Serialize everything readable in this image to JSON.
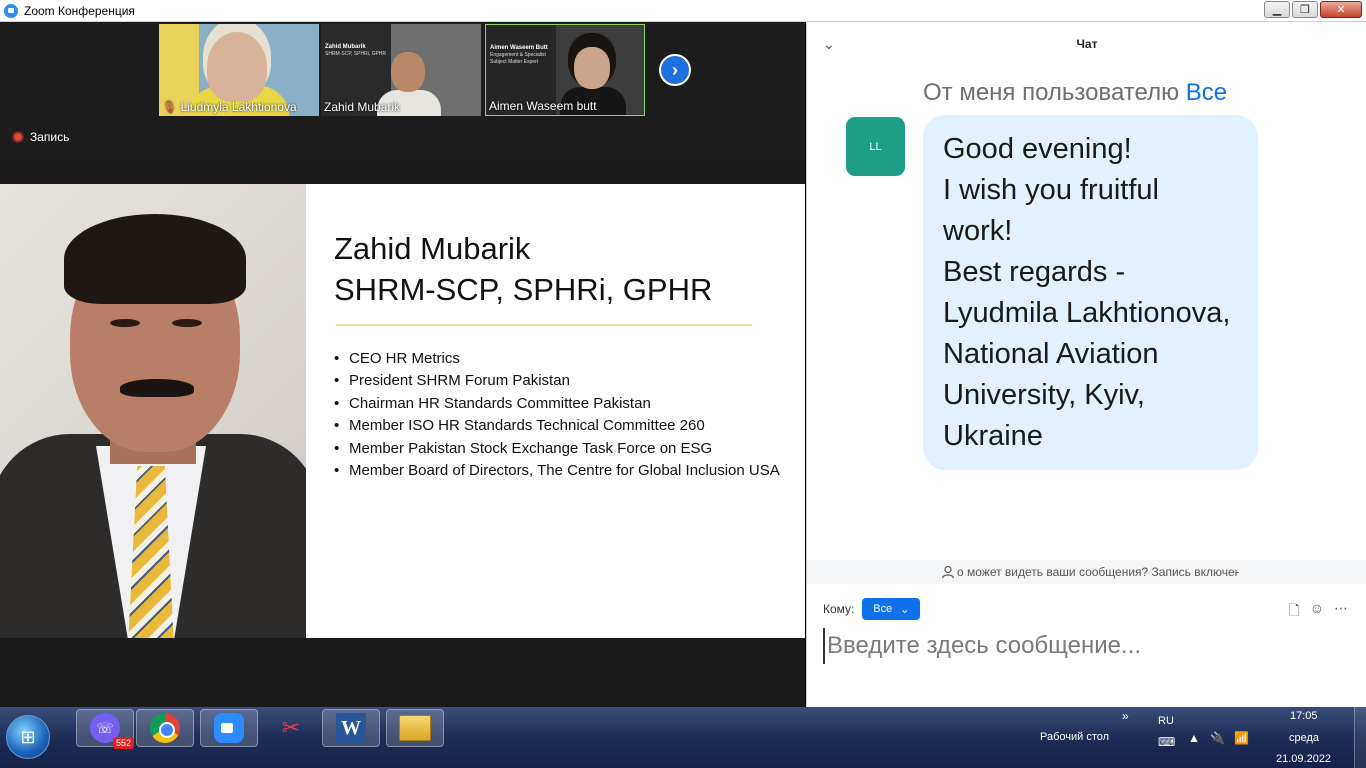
{
  "window": {
    "title": "Zoom Конференция",
    "buttons": {
      "minimize": "▁",
      "maximize": "❐",
      "close": "✕"
    }
  },
  "participants": [
    {
      "name": "Liudmyla Lakhtionova",
      "muted": true
    },
    {
      "name": "Zahid Mubarik"
    },
    {
      "name": "Aimen Waseem butt"
    }
  ],
  "recording": {
    "label": "Запись"
  },
  "slide": {
    "title_line1": "Zahid Mubarik",
    "title_line2": "SHRM-SCP, SPHRi, GPHR",
    "bullets": [
      "CEO HR Metrics",
      "President SHRM Forum Pakistan",
      "Chairman HR Standards Committee Pakistan",
      "Member ISO HR Standards Technical Committee 260",
      "Member Pakistan Stock Exchange Task Force on ESG",
      "Member Board of Directors, The Centre for Global Inclusion USA"
    ]
  },
  "thumb_slides": {
    "t2_title": "Zahid Mubarik",
    "t2_sub": "SHRM-SCP, SPHRi, GPHR",
    "t3_title": "Aimen Waseem Butt",
    "t3_sub": "Engagement & Specialist Subject Matter Expert"
  },
  "chat": {
    "title": "Чат",
    "from_prefix": "От меня пользователю",
    "from_target": "Все",
    "avatar_initials": "LL",
    "message_lines": [
      "Good evening!",
      "I wish you fruitful",
      "work!",
      "Best regards -",
      "Lyudmila Lakhtionova,",
      "National Aviation",
      "University, Kyiv,",
      "Ukraine"
    ],
    "notice": "о может видеть ваши сообщения? Запись включена",
    "to_label": "Кому:",
    "to_value": "Все",
    "input_placeholder": "Введите здесь сообщение..."
  },
  "taskbar": {
    "viber_badge": "552",
    "desktop_label": "Рабочий стол",
    "language": "RU",
    "time": "17:05",
    "day": "среда",
    "date": "21.09.2022"
  },
  "colors": {
    "accent": "#0e71eb",
    "avatar": "#1e9e87",
    "bubble": "#e3f1ff",
    "record": "#e0463a"
  }
}
